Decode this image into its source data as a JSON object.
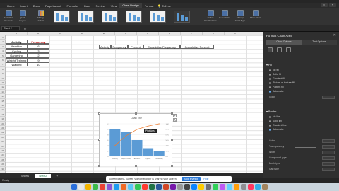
{
  "ribbon": {
    "tabs": [
      "Home",
      "Insert",
      "Draw",
      "Page Layout",
      "Formulas",
      "Data",
      "Review",
      "View",
      "Chart Design",
      "Format"
    ],
    "active_tab": "Chart Design",
    "tell_me": "Tell me",
    "buttons": {
      "add_element": "Add Chart Element",
      "quick_layout": "Quick Layout",
      "change_colors": "Change Colors",
      "switch": "Switch Row/Column",
      "select_data": "Select Data",
      "change_type": "Change Chart Type",
      "move_chart": "Move Chart"
    }
  },
  "namebox": "Chart 2",
  "fx": "fx",
  "columns": [
    "A",
    "B",
    "C",
    "D",
    "E",
    "F",
    "G",
    "H",
    "I",
    "J",
    "K"
  ],
  "rows": [
    "1",
    "2",
    "3",
    "4",
    "5",
    "6",
    "7",
    "8",
    "9",
    "10",
    "11",
    "12",
    "13",
    "14",
    "15",
    "16",
    "17",
    "18",
    "19",
    "20",
    "21",
    "22",
    "23",
    "24",
    "25",
    "26",
    "27",
    "28",
    "29",
    "30"
  ],
  "table1": {
    "headers": [
      "Activity",
      "Frequency"
    ],
    "rows": [
      [
        "Aerobics",
        "6"
      ],
      [
        "Cycling",
        "3"
      ],
      [
        "Gardening",
        "2"
      ],
      [
        "Weight Training",
        "9"
      ],
      [
        "Walking",
        "10"
      ]
    ]
  },
  "table2": {
    "headers": [
      "Activity",
      "Frequency",
      "Percent",
      "Cumulative Frequency",
      "Cumulative Percent"
    ]
  },
  "chart": {
    "title": "Chart Title",
    "tooltip": "Plot Area"
  },
  "chart_data": {
    "type": "bar",
    "title": "Chart Title",
    "categories": [
      "Walking",
      "Weight Training",
      "Aerobics",
      "Cycling",
      "Gardening"
    ],
    "series": [
      {
        "values": [
          10,
          9,
          6,
          3,
          2
        ]
      },
      {
        "values": [
          33,
          63,
          83,
          93,
          100
        ]
      }
    ],
    "ylim": [
      0,
      12
    ],
    "y2lim": [
      0,
      100
    ]
  },
  "sheet_tabs": [
    "Sheet1",
    "Sheet2"
  ],
  "active_sheet": "Sheet2",
  "status": {
    "ready": "Ready",
    "banner": "Screencastify - Screen Video Recorder is sharing your screen.",
    "stop": "Stop sharing",
    "hide": "Hide"
  },
  "pane": {
    "title": "Format Chart Area",
    "tabs": [
      "Chart Options",
      "Text Options"
    ],
    "fill_section": "Fill",
    "fill_options": [
      "No fill",
      "Solid fill",
      "Gradient fill",
      "Picture or texture fill",
      "Pattern fill",
      "Automatic"
    ],
    "color_label": "Color",
    "border_section": "Border",
    "border_options": [
      "No line",
      "Solid line",
      "Gradient line",
      "Automatic"
    ],
    "border_fields": [
      "Color",
      "Transparency",
      "Width",
      "Compound type",
      "Dash type",
      "Cap type"
    ]
  },
  "colors": {
    "bar": "#5b9bd5",
    "line": "#ed7d31",
    "accent": "#217346"
  }
}
